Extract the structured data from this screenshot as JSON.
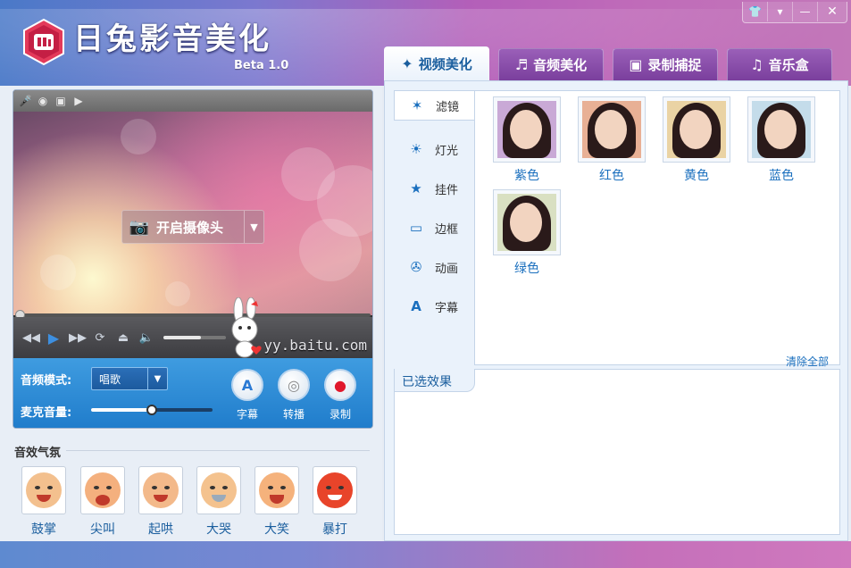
{
  "app": {
    "title": "日兔影音美化",
    "version": "Beta 1.0"
  },
  "window_controls": [
    "shirt-icon",
    "menu-icon",
    "minimize-icon",
    "close-icon"
  ],
  "tabs": [
    {
      "label": "视频美化",
      "icon": "video-beauty-icon",
      "active": true
    },
    {
      "label": "音频美化",
      "icon": "audio-beauty-icon",
      "active": false
    },
    {
      "label": "录制捕捉",
      "icon": "record-capture-icon",
      "active": false
    },
    {
      "label": "音乐盒",
      "icon": "music-note-icon",
      "active": false
    }
  ],
  "player": {
    "camera_button": "开启摄像头",
    "watermark": "yy.baitu.com",
    "volume_level": 0.6
  },
  "audio": {
    "mode_label": "音频模式:",
    "mode_value": "唱歌",
    "mic_label": "麦克音量:",
    "mic_level": 0.5,
    "buttons": [
      {
        "label": "字幕",
        "glyph": "A"
      },
      {
        "label": "转播",
        "glyph": "◎"
      },
      {
        "label": "录制",
        "glyph": "●"
      }
    ]
  },
  "emotes": {
    "title": "音效气氛",
    "items": [
      {
        "label": "鼓掌",
        "color": "#f3c08e"
      },
      {
        "label": "尖叫",
        "color": "#f4b07e"
      },
      {
        "label": "起哄",
        "color": "#f3b98a"
      },
      {
        "label": "大哭",
        "color": "#f4c28e"
      },
      {
        "label": "大笑",
        "color": "#f5b27c"
      },
      {
        "label": "暴打",
        "color": "#e8442a"
      }
    ]
  },
  "side_menu": [
    {
      "label": "滤镜",
      "icon": "sparkle-icon",
      "active": true
    },
    {
      "label": "灯光",
      "icon": "sun-icon",
      "active": false
    },
    {
      "label": "挂件",
      "icon": "pendant-icon",
      "active": false
    },
    {
      "label": "边框",
      "icon": "frame-icon",
      "active": false
    },
    {
      "label": "动画",
      "icon": "film-reel-icon",
      "active": false
    },
    {
      "label": "字幕",
      "icon": "letter-a-icon",
      "active": false
    }
  ],
  "filters": [
    {
      "label": "紫色",
      "tint": "#c9a9d6"
    },
    {
      "label": "红色",
      "tint": "#e8b095"
    },
    {
      "label": "黄色",
      "tint": "#ead3a4"
    },
    {
      "label": "蓝色",
      "tint": "#c4dcea"
    },
    {
      "label": "绿色",
      "tint": "#d9e0c2"
    }
  ],
  "selected": {
    "title": "已选效果",
    "clear": "清除全部"
  }
}
